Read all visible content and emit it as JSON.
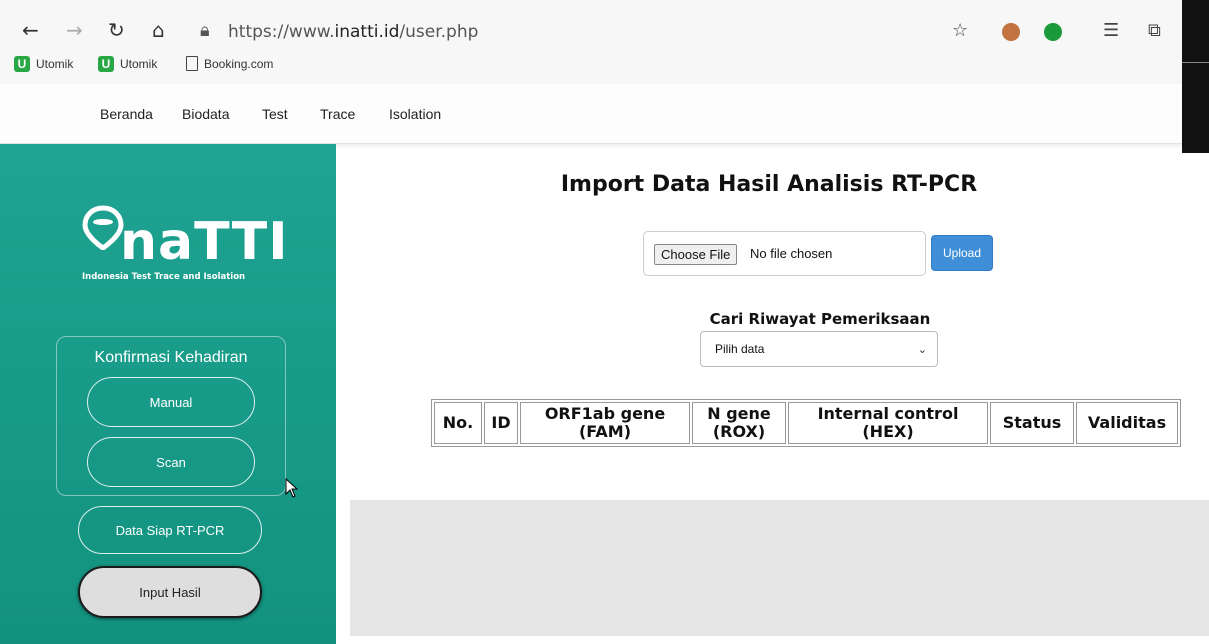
{
  "browser": {
    "url_prefix": "https://www.",
    "url_host": "inatti.id",
    "url_path": "/user.php",
    "bookmarks": [
      {
        "label": "Utomik"
      },
      {
        "label": "Utomik"
      },
      {
        "label": "Booking.com"
      }
    ]
  },
  "site_nav": {
    "items": [
      "Beranda",
      "Biodata",
      "Test",
      "Trace",
      "Isolation"
    ]
  },
  "sidebar": {
    "logo_text": "naTTI",
    "logo_sub": "Indonesia Test Trace and Isolation",
    "konfirmasi_title": "Konfirmasi Kehadiran",
    "manual_label": "Manual",
    "scan_label": "Scan",
    "data_siap_label": "Data Siap RT-PCR",
    "input_hasil_label": "Input Hasil"
  },
  "main": {
    "title": "Import Data Hasil Analisis RT-PCR",
    "choose_file_label": "Choose File",
    "no_file_text": "No file chosen",
    "upload_label": "Upload",
    "cari_label": "Cari Riwayat Pemeriksaan",
    "select_value": "Pilih data",
    "table_headers": [
      {
        "line1": "No.",
        "line2": ""
      },
      {
        "line1": "ID",
        "line2": ""
      },
      {
        "line1": "ORF1ab gene",
        "line2": "(FAM)"
      },
      {
        "line1": "N gene",
        "line2": "(ROX)"
      },
      {
        "line1": "Internal control",
        "line2": "(HEX)"
      },
      {
        "line1": "Status",
        "line2": ""
      },
      {
        "line1": "Validitas",
        "line2": ""
      }
    ]
  },
  "colors": {
    "sidebar": "#1fa392",
    "upload": "#3f8ed8"
  }
}
